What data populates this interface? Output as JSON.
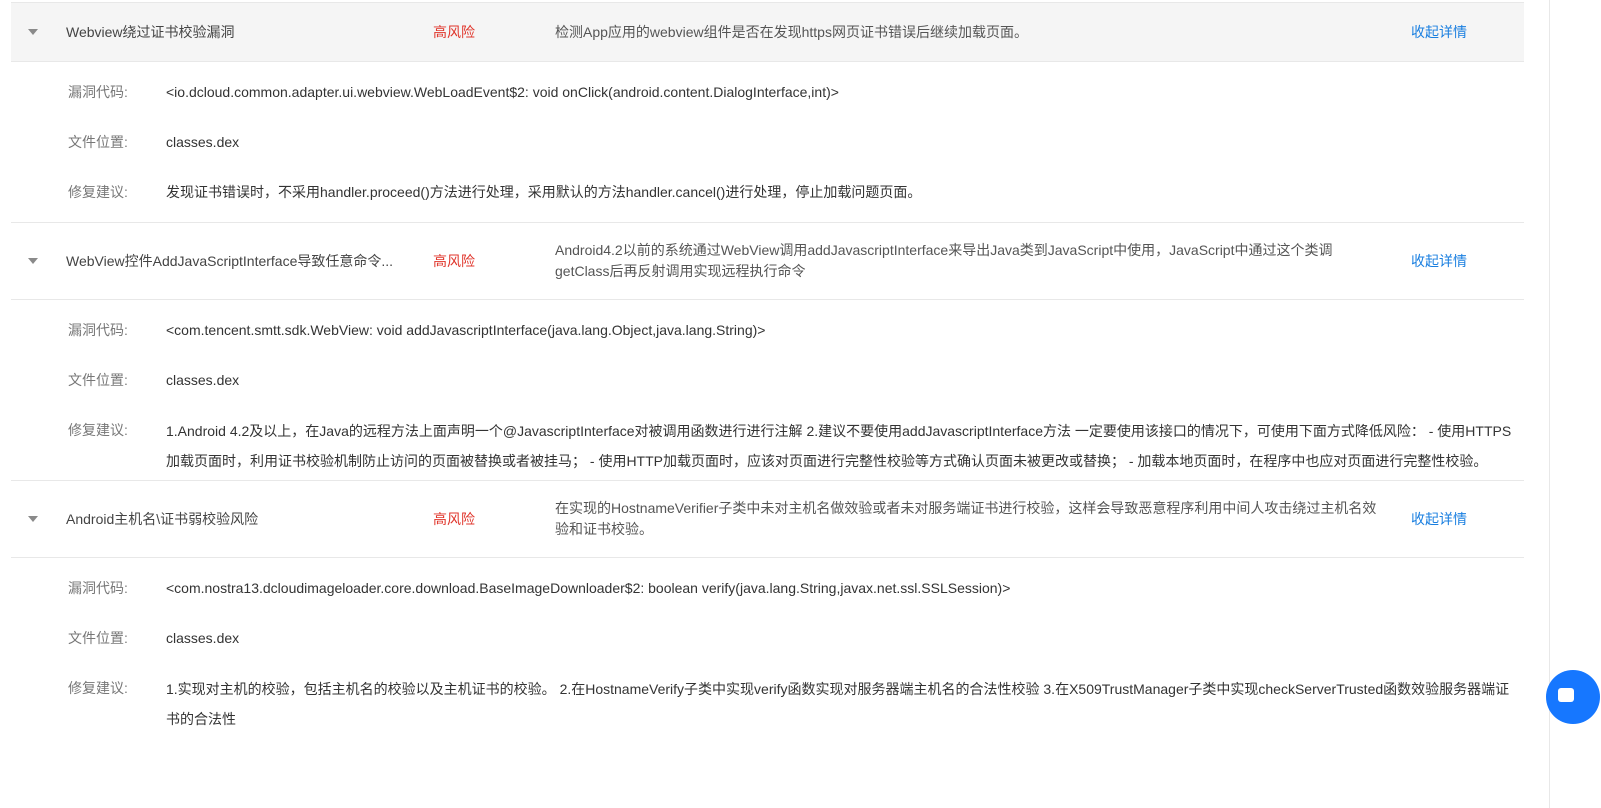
{
  "labels": {
    "code": "漏洞代码:",
    "file": "文件位置:",
    "fix": "修复建议:"
  },
  "vulnerabilities": [
    {
      "name": "Webview绕过证书校验漏洞",
      "risk": "高风险",
      "description": "检测App应用的webview组件是否在发现https网页证书错误后继续加载页面。",
      "toggle": "收起详情",
      "code": "<io.dcloud.common.adapter.ui.webview.WebLoadEvent$2: void onClick(android.content.DialogInterface,int)>",
      "file": "classes.dex",
      "fix": "发现证书错误时，不采用handler.proceed()方法进行处理，采用默认的方法handler.cancel()进行处理，停止加载问题页面。"
    },
    {
      "name": "WebView控件AddJavaScriptInterface导致任意命令...",
      "risk": "高风险",
      "description": "Android4.2以前的系统通过WebView调用addJavascriptInterface来导出Java类到JavaScript中使用，JavaScript中通过这个类调getClass后再反射调用实现远程执行命令",
      "toggle": "收起详情",
      "code": "<com.tencent.smtt.sdk.WebView: void addJavascriptInterface(java.lang.Object,java.lang.String)>",
      "file": "classes.dex",
      "fix": "1.Android 4.2及以上，在Java的远程方法上面声明一个@JavascriptInterface对被调用函数进行进行注解 2.建议不要使用addJavascriptInterface方法 一定要使用该接口的情况下，可使用下面方式降低风险： - 使用HTTPS加载页面时，利用证书校验机制防止访问的页面被替换或者被挂马； - 使用HTTP加载页面时，应该对页面进行完整性校验等方式确认页面未被更改或替换； - 加载本地页面时，在程序中也应对页面进行完整性校验。"
    },
    {
      "name": "Android主机名\\证书弱校验风险",
      "risk": "高风险",
      "description": "在实现的HostnameVerifier子类中未对主机名做效验或者未对服务端证书进行校验，这样会导致恶意程序利用中间人攻击绕过主机名效验和证书校验。",
      "toggle": "收起详情",
      "code": "<com.nostra13.dcloudimageloader.core.download.BaseImageDownloader$2: boolean verify(java.lang.String,javax.net.ssl.SSLSession)>",
      "file": "classes.dex",
      "fix": "1.实现对主机的校验，包括主机名的校验以及主机证书的校验。 2.在HostnameVerify子类中实现verify函数实现对服务器端主机名的合法性校验 3.在X509TrustManager子类中实现checkServerTrusted函数效验服务器端证书的合法性"
    }
  ],
  "colors": {
    "risk_high": "#e0352b",
    "link": "#1a7fe0",
    "fab": "#1677ff"
  },
  "icons": {
    "expand": "caret-down-icon",
    "chat": "chat-bubble-icon"
  }
}
